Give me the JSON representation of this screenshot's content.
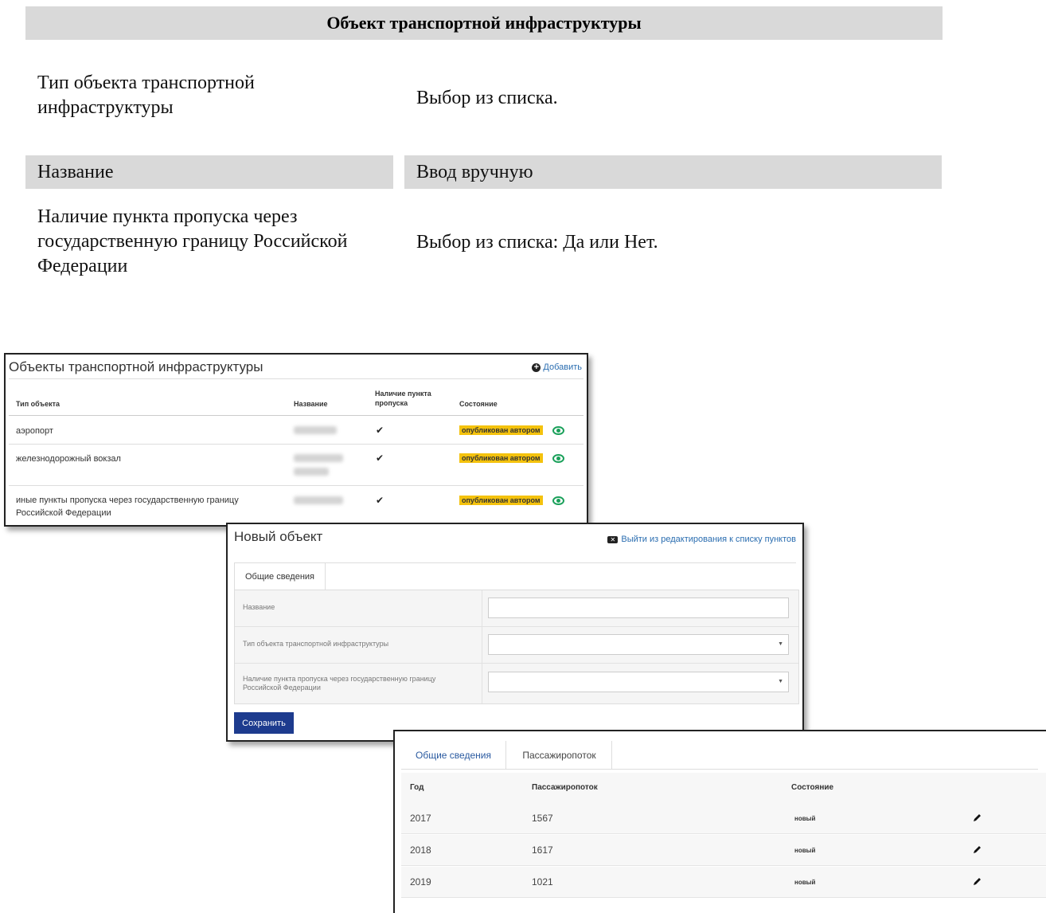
{
  "doc": {
    "heading": "Объект транспортной инфраструктуры",
    "rows": [
      {
        "label": "Тип объекта транспортной инфраструктуры",
        "value": "Выбор из списка."
      },
      {
        "label": "Название",
        "value": "Ввод вручную"
      },
      {
        "label": "Наличие пункта пропуска через государственную границу Российской Федерации",
        "value": "Выбор из списка: Да или Нет."
      }
    ]
  },
  "list_panel": {
    "title": "Объекты транспортной инфраструктуры",
    "add_label": "Добавить",
    "columns": [
      "Тип объекта",
      "Название",
      "Наличие пункта пропуска",
      "Состояние"
    ],
    "rows": [
      {
        "type": "аэропорт",
        "has_checkpoint": "✔",
        "status": "опубликован автором"
      },
      {
        "type": "железнодорожный вокзал",
        "has_checkpoint": "✔",
        "status": "опубликован автором"
      },
      {
        "type": "иные пункты пропуска через государственную границу Российской Федерации",
        "has_checkpoint": "✔",
        "status": "опубликован автором"
      }
    ],
    "status_color": "#f4c20d",
    "view_icon_color": "#1aa05a"
  },
  "form_panel": {
    "title": "Новый объект",
    "exit_label": "Выйти из редактирования к списку пунктов",
    "tab_label": "Общие сведения",
    "fields": [
      {
        "label": "Название",
        "kind": "text"
      },
      {
        "label": "Тип объекта транспортной инфраструктуры",
        "kind": "select"
      },
      {
        "label": "Наличие пункта пропуска через государственную границу Российской Федерации",
        "kind": "select"
      }
    ],
    "save_label": "Сохранить",
    "save_color": "#1d3b8e"
  },
  "flow_panel": {
    "tabs": [
      "Общие сведения",
      "Пассажиропоток"
    ],
    "columns": [
      "Год",
      "Пассажиропоток",
      "Состояние"
    ],
    "rows": [
      {
        "year": "2017",
        "flow": "1567",
        "status": "новый"
      },
      {
        "year": "2018",
        "flow": "1617",
        "status": "новый"
      },
      {
        "year": "2019",
        "flow": "1021",
        "status": "новый"
      }
    ]
  }
}
